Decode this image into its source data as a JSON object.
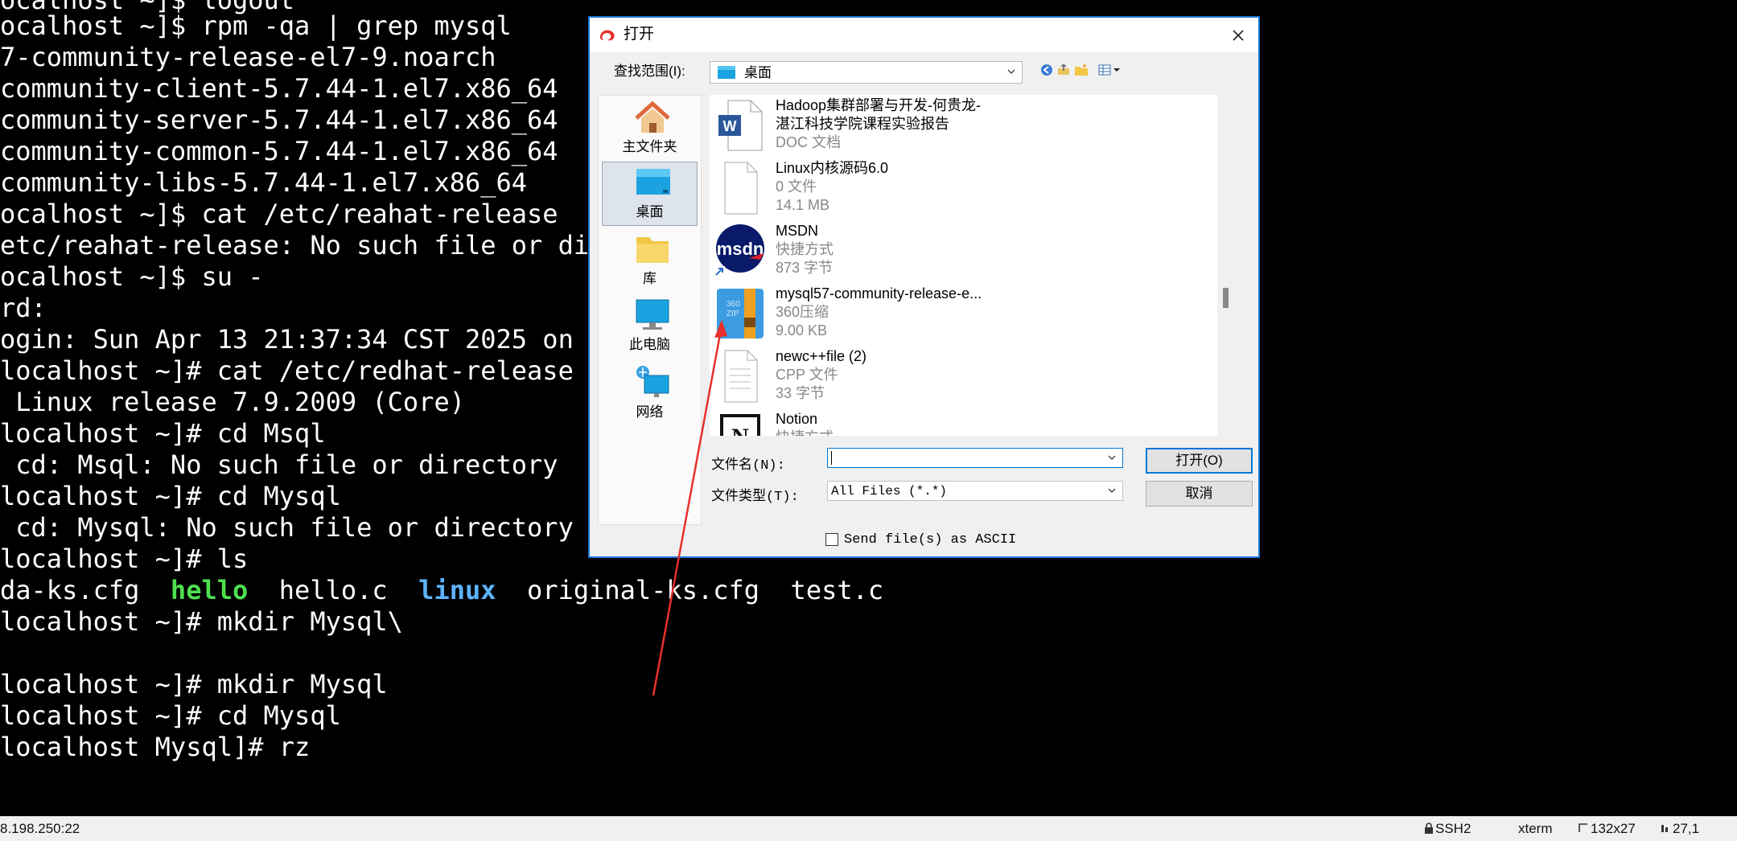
{
  "terminal": {
    "lines": [
      "ocalhost ~]$ logout",
      "ocalhost ~]$ rpm -qa | grep mysql",
      "7-community-release-el7-9.noarch",
      "community-client-5.7.44-1.el7.x86_64",
      "community-server-5.7.44-1.el7.x86_64",
      "community-common-5.7.44-1.el7.x86_64",
      "community-libs-5.7.44-1.el7.x86_64",
      "ocalhost ~]$ cat /etc/reahat-release",
      "etc/reahat-release: No such file or dir",
      "ocalhost ~]$ su -",
      "rd:",
      "ogin: Sun Apr 13 21:37:34 CST 2025 on p",
      "localhost ~]# cat /etc/redhat-release",
      " Linux release 7.9.2009 (Core)",
      "localhost ~]# cd Msql",
      " cd: Msql: No such file or directory",
      "localhost ~]# cd Mysql",
      " cd: Mysql: No such file or directory",
      "localhost ~]# ls",
      "",
      "localhost ~]# mkdir Mysql\\",
      "",
      "localhost ~]# mkdir Mysql",
      "localhost ~]# cd Mysql",
      "localhost Mysql]# rz"
    ],
    "ls_output": {
      "part1": "da-ks.cfg  ",
      "hello": "hello",
      "part2": "  hello.c  ",
      "linux": "linux",
      "part3": "  original-ks.cfg  test.c"
    },
    "colors": {
      "background": "#000000",
      "text": "#ffffff",
      "dir": "#5eb3ff",
      "exec": "#4fe04f"
    }
  },
  "status_bar": {
    "host": "8.198.250:22",
    "protocol": "SSH2",
    "terminal_type": "xterm",
    "size": "132x27",
    "cursor": "27,1"
  },
  "dialog": {
    "title": "打开",
    "look_in_label": "查找范围(I):",
    "look_in_value": "桌面",
    "places": [
      {
        "label": "主文件夹",
        "icon": "home-icon"
      },
      {
        "label": "桌面",
        "icon": "desktop-icon",
        "selected": true
      },
      {
        "label": "库",
        "icon": "library-folder-icon"
      },
      {
        "label": "此电脑",
        "icon": "computer-icon"
      },
      {
        "label": "网络",
        "icon": "network-icon"
      }
    ],
    "files": [
      {
        "name_line1": "Hadoop集群部署与开发-何贵龙-",
        "name_line2": "湛江科技学院课程实验报告",
        "type": "DOC 文档",
        "icon": "word-doc-icon"
      },
      {
        "name": "Linux内核源码6.0",
        "type": "0 文件",
        "size": "14.1 MB",
        "icon": "blank-file-icon"
      },
      {
        "name": "MSDN",
        "type": "快捷方式",
        "size": "873 字节",
        "icon": "msdn-shortcut-icon"
      },
      {
        "name": "mysql57-community-release-e...",
        "type": "360压缩",
        "size": "9.00 KB",
        "icon": "zip-archive-icon"
      },
      {
        "name": "newc++file (2)",
        "type": "CPP 文件",
        "size": "33 字节",
        "icon": "cpp-file-icon"
      },
      {
        "name": "Notion",
        "type": "快捷方式",
        "icon": "notion-icon"
      }
    ],
    "filename_label": "文件名(N):",
    "filename_value": "",
    "filetype_label": "文件类型(T):",
    "filetype_value": "All Files (*.*)",
    "open_button": "打开(O)",
    "cancel_button": "取消",
    "ascii_checkbox_label": "Send file(s) as ASCII",
    "ascii_checked": false
  },
  "colors": {
    "accent": "#1a7ad6",
    "annotation_arrow": "#e8302a"
  }
}
